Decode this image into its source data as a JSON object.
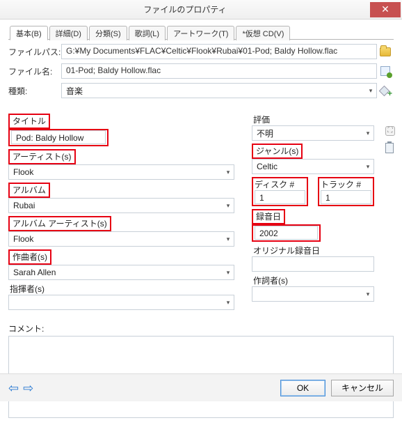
{
  "window": {
    "title": "ファイルのプロパティ"
  },
  "tabs": {
    "t0": "基本(<u>B</u>)",
    "t1": "詳細(<u>D</u>)",
    "t2": "分類(<u>S</u>)",
    "t3": "歌詞(<u>L</u>)",
    "t4": "アートワーク(<u>T</u>)",
    "t5": "*仮想 CD(<u>V</u>)",
    "t0p": "基本(B)",
    "t1p": "詳細(D)",
    "t2p": "分類(S)",
    "t3p": "歌詞(L)",
    "t4p": "アートワーク(T)",
    "t5p": "*仮想 CD(V)"
  },
  "labels": {
    "filepath": "ファイルパス:",
    "filename": "ファイル名:",
    "kind": "種類:",
    "title": "タイトル",
    "artist": "アーティスト(s)",
    "album": "アルバム",
    "album_artist": "アルバム アーティスト(s)",
    "composer": "作曲者(s)",
    "conductor": "指揮者(s)",
    "rating": "評価",
    "genre": "ジャンル(s)",
    "disc_no": "ディスク #",
    "track_no": "トラック #",
    "rec_date": "録音日",
    "orig_date": "オリジナル録音日",
    "lyricist": "作詞者(s)",
    "comment": "コメント:"
  },
  "values": {
    "filepath": "G:¥My Documents¥FLAC¥Celtic¥Flook¥Rubai¥01-Pod; Baldy Hollow.flac",
    "filename": "01-Pod; Baldy Hollow.flac",
    "kind": "音楽",
    "title": "Pod: Baldy Hollow",
    "artist": "Flook",
    "album": "Rubai",
    "album_artist": "Flook",
    "composer": "Sarah Allen",
    "conductor": "",
    "rating": "不明",
    "genre": "Celtic",
    "disc_no": "1",
    "track_no": "1",
    "rec_date": "2002",
    "orig_date": "",
    "lyricist": "",
    "comment": ""
  },
  "buttons": {
    "ok": "OK",
    "cancel": "キャンセル"
  }
}
